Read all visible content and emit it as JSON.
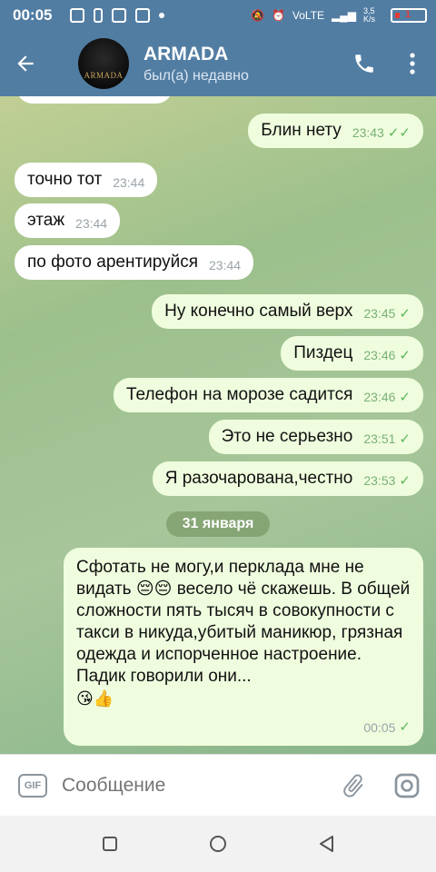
{
  "statusbar": {
    "time": "00:05",
    "battery": "1",
    "net_speed": "3,5 K/s"
  },
  "header": {
    "name": "ARMADA",
    "status": "был(а) недавно",
    "avatar_text": "ARMADA"
  },
  "messages": [
    {
      "text": "Блин нету",
      "time": "23:43",
      "dir": "out"
    },
    {
      "text": "точно тот",
      "time": "23:44",
      "dir": "in"
    },
    {
      "text": "этаж",
      "time": "23:44",
      "dir": "in"
    },
    {
      "text": "по фото арентируйся",
      "time": "23:44",
      "dir": "in"
    },
    {
      "text": "Ну конечно самый верх",
      "time": "23:45",
      "dir": "out"
    },
    {
      "text": "Пиздец",
      "time": "23:46",
      "dir": "out"
    },
    {
      "text": "Телефон на морозе садится",
      "time": "23:46",
      "dir": "out"
    },
    {
      "text": "Это не серьезно",
      "time": "23:51",
      "dir": "out"
    },
    {
      "text": "Я разочарована,честно",
      "time": "23:53",
      "dir": "out"
    }
  ],
  "date_divider": "31 января",
  "long_message": {
    "text": "Сфотать не могу,и перклада мне не видать 😔😔 весело чё скажешь. В общей сложности пять тысяч в совокупности с такси в никуда,убитый маникюр, грязная одежда и испорченное настроение. Падик говорили они...",
    "emojis": "😘👍",
    "time": "00:05"
  },
  "input": {
    "placeholder": "Сообщение",
    "gif_label": "GIF"
  },
  "colors": {
    "header": "#527da3",
    "outgoing": "#effdde",
    "incoming": "#ffffff",
    "tick": "#5db75a"
  }
}
